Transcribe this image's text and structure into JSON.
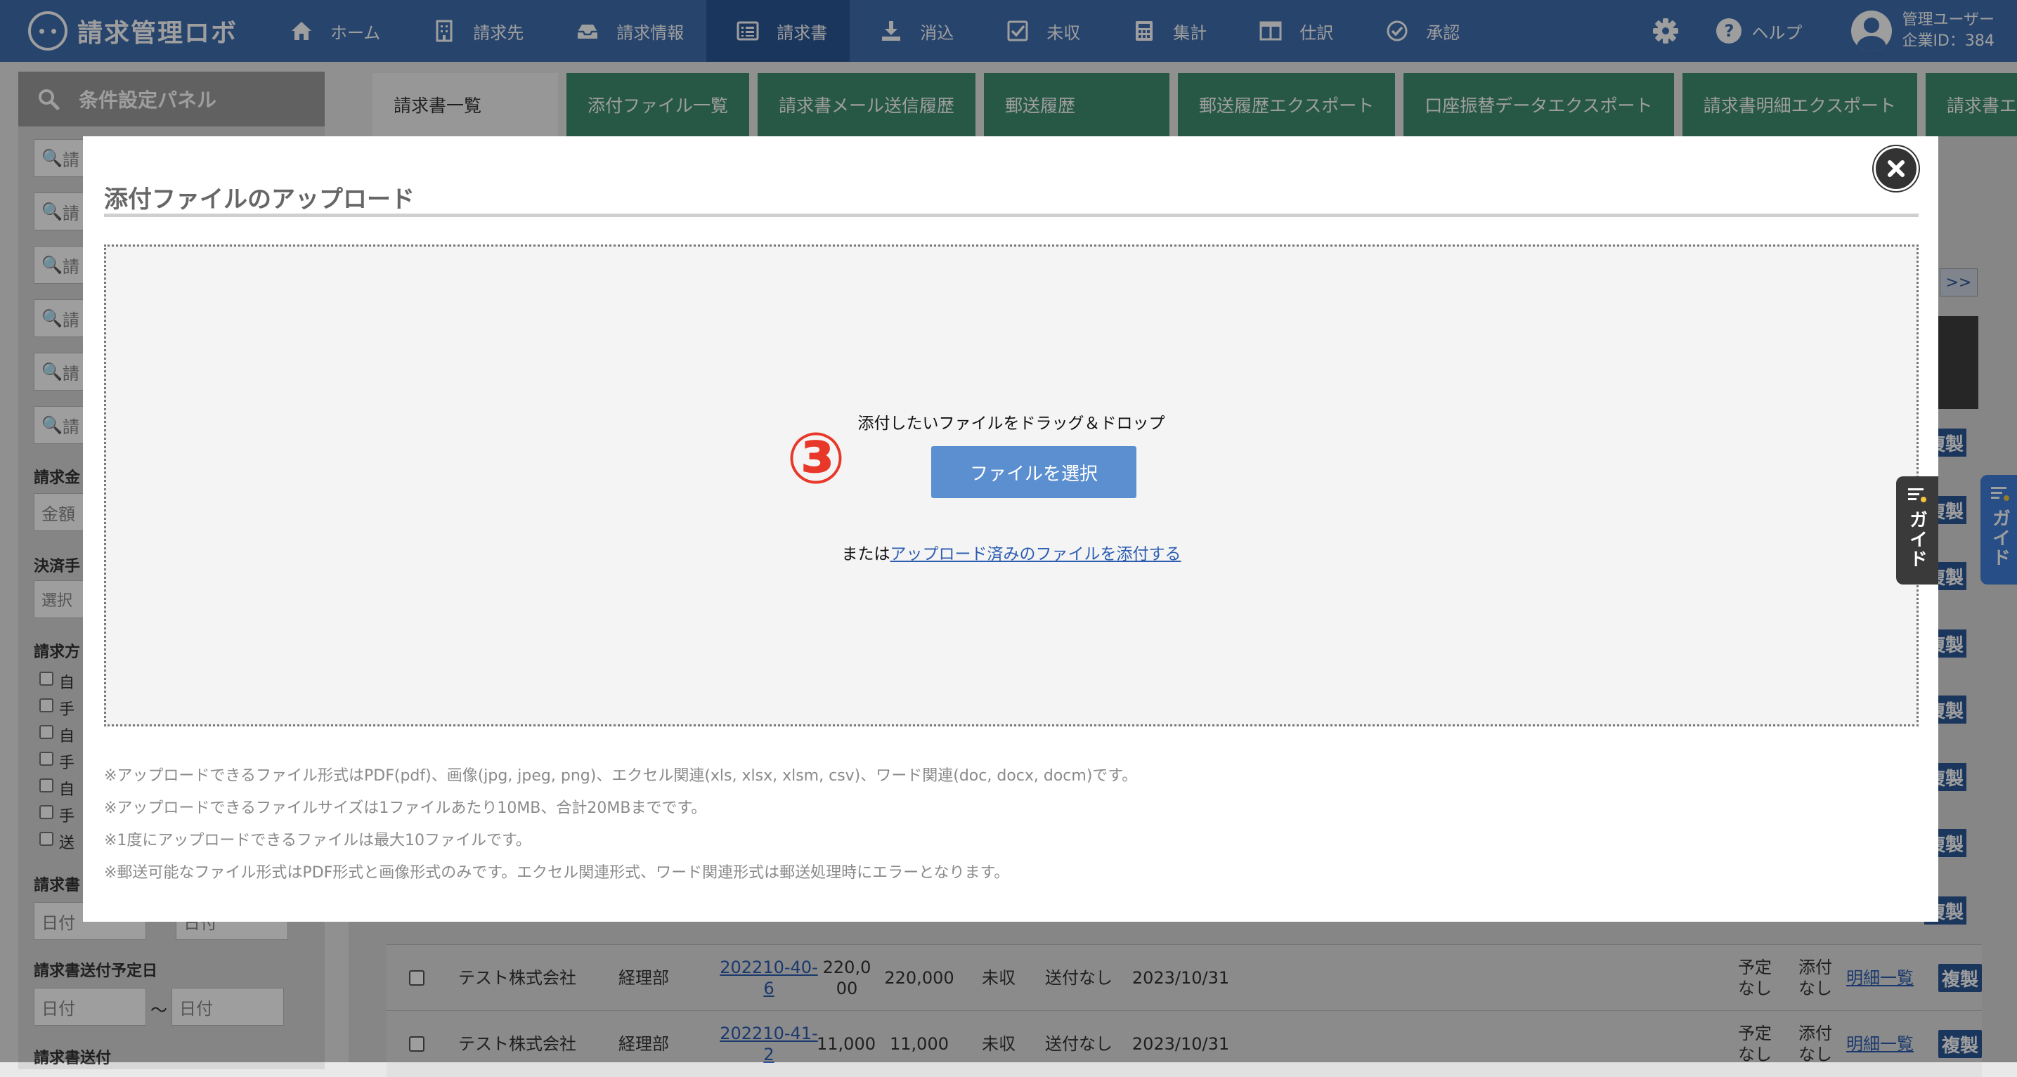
{
  "app": {
    "logo_text": "請求管理ロボ"
  },
  "nav": {
    "items": [
      {
        "label": "ホーム",
        "icon": "home-icon"
      },
      {
        "label": "請求先",
        "icon": "building-icon"
      },
      {
        "label": "請求情報",
        "icon": "inbox-icon"
      },
      {
        "label": "請求書",
        "icon": "list-icon",
        "active": true
      },
      {
        "label": "消込",
        "icon": "download-icon"
      },
      {
        "label": "未収",
        "icon": "checkbox-icon"
      },
      {
        "label": "集計",
        "icon": "calculator-icon"
      },
      {
        "label": "仕訳",
        "icon": "columns-icon"
      },
      {
        "label": "承認",
        "icon": "check-circle-icon"
      }
    ],
    "help_label": "ヘルプ",
    "user_name": "管理ユーザー",
    "company_id": "企業ID：384"
  },
  "panel": {
    "title": "条件設定パネル",
    "search_fields": [
      "請",
      "請",
      "請",
      "請",
      "請",
      "請"
    ],
    "amount_label": "請求金",
    "amount_placeholder": "金額",
    "payment_label": "決済手",
    "payment_select": "選択",
    "method_label": "請求方",
    "method_checks": [
      "自",
      "手",
      "自",
      "手",
      "自",
      "手",
      "送"
    ],
    "date_label": "請求書",
    "date_from": "日付",
    "date_to": "日付",
    "send_date_label": "請求書送付予定日",
    "send_from": "日付",
    "send_tilde": "〜",
    "send_to": "日付",
    "send_label": "請求書送付"
  },
  "tabs": [
    "請求書一覧",
    "添付ファイル一覧",
    "請求書メール送信履歴",
    "郵送履歴",
    "郵送履歴エクスポート",
    "口座振替データエクスポート",
    "請求書明細エクスポート",
    "請求書エクスポ"
  ],
  "table": {
    "next_label": ">>",
    "side_dup_label": "複製",
    "rows": [
      {
        "company": "テスト株式会社",
        "dept": "経理部",
        "number": "202210-40-6",
        "amount": "220,000",
        "total": "220,000",
        "status": "未収",
        "send": "送付なし",
        "date": "2023/10/31",
        "plan": "予定なし",
        "attach": "添付なし",
        "detail": "明細一覧",
        "dup": "複製"
      },
      {
        "company": "テスト株式会社",
        "dept": "経理部",
        "number": "202210-41-2",
        "amount": "11,000",
        "total": "11,000",
        "status": "未収",
        "send": "送付なし",
        "date": "2023/10/31",
        "plan": "予定なし",
        "attach": "添付なし",
        "detail": "明細一覧",
        "dup": "複製"
      }
    ]
  },
  "guide_label": "ガイド",
  "modal": {
    "title": "添付ファイルのアップロード",
    "drop_text": "添付したいファイルをドラッグ＆ドロップ",
    "select_button": "ファイルを選択",
    "or_prefix": "または",
    "or_link": "アップロード済みのファイルを添付する",
    "step_marker": "③",
    "notes": [
      "※アップロードできるファイル形式はPDF(pdf)、画像(jpg, jpeg, png)、エクセル関連(xls, xlsx, xlsm, csv)、ワード関連(doc, docx, docm)です。",
      "※アップロードできるファイルサイズは1ファイルあたり10MB、合計20MBまでです。",
      "※1度にアップロードできるファイルは最大10ファイルです。",
      "※郵送可能なファイル形式はPDF形式と画像形式のみです。エクセル関連形式、ワード関連形式は郵送処理時にエラーとなります。"
    ]
  },
  "colors": {
    "nav_bg": "#3f6fb0",
    "nav_active": "#2c5896",
    "tab_green": "#3f8f72",
    "button_blue": "#5b8fcf",
    "step_red": "#e8382a"
  }
}
